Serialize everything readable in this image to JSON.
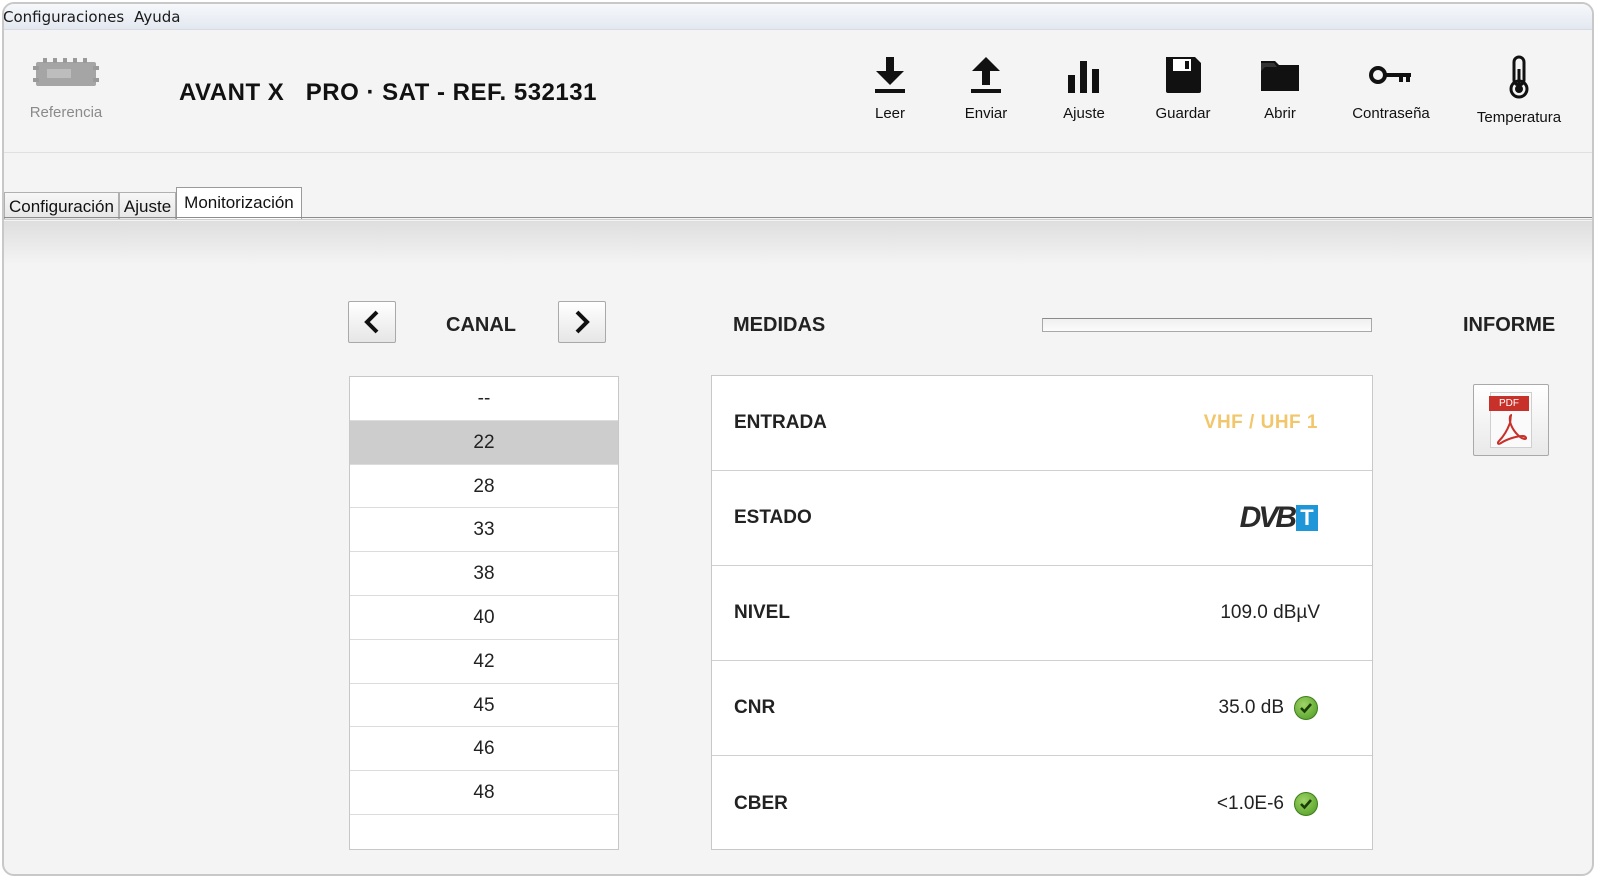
{
  "menubar": {
    "items": [
      "Configuraciones",
      "Ayuda"
    ]
  },
  "header": {
    "reference_label": "Referencia",
    "title": "AVANT X   PRO · SAT - REF. 532131"
  },
  "toolbar": {
    "items": [
      {
        "label": "Leer",
        "icon": "download-icon"
      },
      {
        "label": "Enviar",
        "icon": "upload-icon"
      },
      {
        "label": "Ajuste",
        "icon": "bar-chart-icon"
      },
      {
        "label": "Guardar",
        "icon": "floppy-disk-icon"
      },
      {
        "label": "Abrir",
        "icon": "folder-icon"
      },
      {
        "label": "Contraseña",
        "icon": "key-icon"
      },
      {
        "label": "Temperatura",
        "icon": "thermometer-icon"
      }
    ]
  },
  "tabs": [
    {
      "label": "Configuración",
      "active": false
    },
    {
      "label": "Ajuste",
      "active": false
    },
    {
      "label": "Monitorización",
      "active": true
    }
  ],
  "canal": {
    "heading": "CANAL",
    "channels": [
      "--",
      "22",
      "28",
      "33",
      "38",
      "40",
      "42",
      "45",
      "46",
      "48"
    ],
    "selected": "22"
  },
  "medidas": {
    "heading": "MEDIDAS",
    "progress": 0,
    "rows": [
      {
        "label": "ENTRADA",
        "value": "VHF / UHF 1",
        "accent_color": "#f2c66a"
      },
      {
        "label": "ESTADO",
        "value": "DVB",
        "badge": "T"
      },
      {
        "label": "NIVEL",
        "value": "109.0 dBµV"
      },
      {
        "label": "CNR",
        "value": "35.0 dB",
        "status": "ok"
      },
      {
        "label": "CBER",
        "value": "<1.0E-6",
        "status": "ok"
      }
    ]
  },
  "informe": {
    "heading": "INFORME",
    "pdf_tag": "PDF"
  }
}
